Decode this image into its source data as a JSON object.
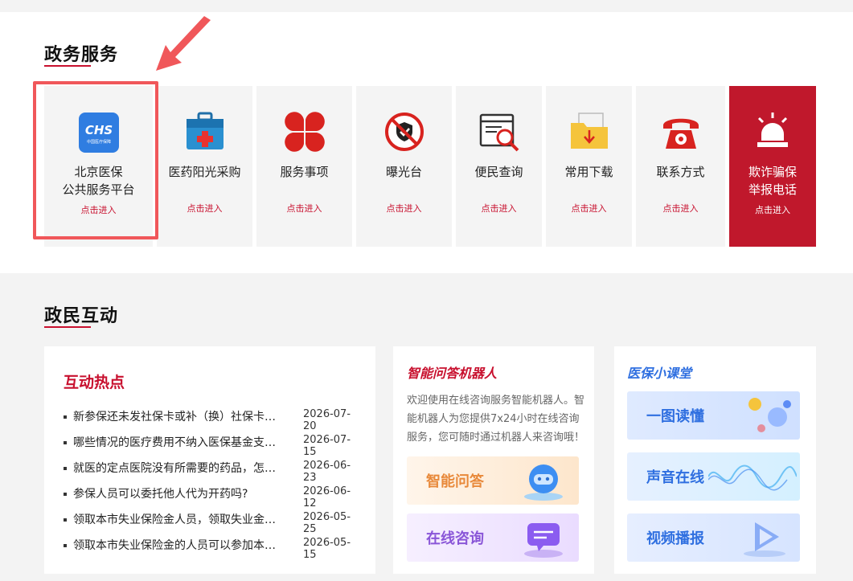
{
  "gov_services": {
    "title": "政务服务",
    "tiles": [
      {
        "name_line1": "北京医保",
        "name_line2": "公共服务平台",
        "enter": "点击进入",
        "icon": "chs-logo-icon",
        "logo_text": "CHS",
        "logo_sub": "中国医疗保障"
      },
      {
        "name_line1": "医药阳光采购",
        "enter": "点击进入",
        "icon": "medical-kit-icon"
      },
      {
        "name_line1": "服务事项",
        "enter": "点击进入",
        "icon": "clover-icon"
      },
      {
        "name_line1": "曝光台",
        "enter": "点击进入",
        "icon": "no-fraud-shield-icon"
      },
      {
        "name_line1": "便民查询",
        "enter": "点击进入",
        "icon": "search-browser-icon"
      },
      {
        "name_line1": "常用下载",
        "enter": "点击进入",
        "icon": "download-folder-icon"
      },
      {
        "name_line1": "联系方式",
        "enter": "点击进入",
        "icon": "telephone-icon"
      },
      {
        "name_line1": "欺诈骗保",
        "name_line2": "举报电话",
        "enter": "点击进入",
        "icon": "alarm-light-icon"
      }
    ]
  },
  "interaction": {
    "title": "政民互动",
    "hot": {
      "title": "互动热点",
      "items": [
        {
          "text": "新参保还未发社保卡或补（换）社保卡期间，如何就医？",
          "date": "2026-07-20"
        },
        {
          "text": "哪些情况的医疗费用不纳入医保基金支付范围？",
          "date": "2026-07-15"
        },
        {
          "text": "就医的定点医院没有所需要的药品，怎么办？",
          "date": "2026-06-23"
        },
        {
          "text": "参保人员可以委托他人代为开药吗?",
          "date": "2026-06-12"
        },
        {
          "text": "领取本市失业保险金人员，领取失业金期间如何参保？",
          "date": "2026-05-25"
        },
        {
          "text": "领取本市失业保险金的人员可以参加本市医疗保险吗？",
          "date": "2026-05-15"
        }
      ]
    },
    "robot": {
      "title": "智能问答机器人",
      "desc": "欢迎使用在线咨询服务智能机器人。智能机器人为您提供7x24小时在线咨询服务，您可随时通过机器人来咨询哦！",
      "btn_qa": "智能问答",
      "btn_consult": "在线咨询"
    },
    "classroom": {
      "title": "医保小课堂",
      "btn_picture": "一图读懂",
      "btn_audio": "声音在线",
      "btn_video": "视频播报"
    }
  },
  "colors": {
    "accent": "#c8102e",
    "highlight": "#f0575a",
    "blue": "#2f6fe0"
  }
}
